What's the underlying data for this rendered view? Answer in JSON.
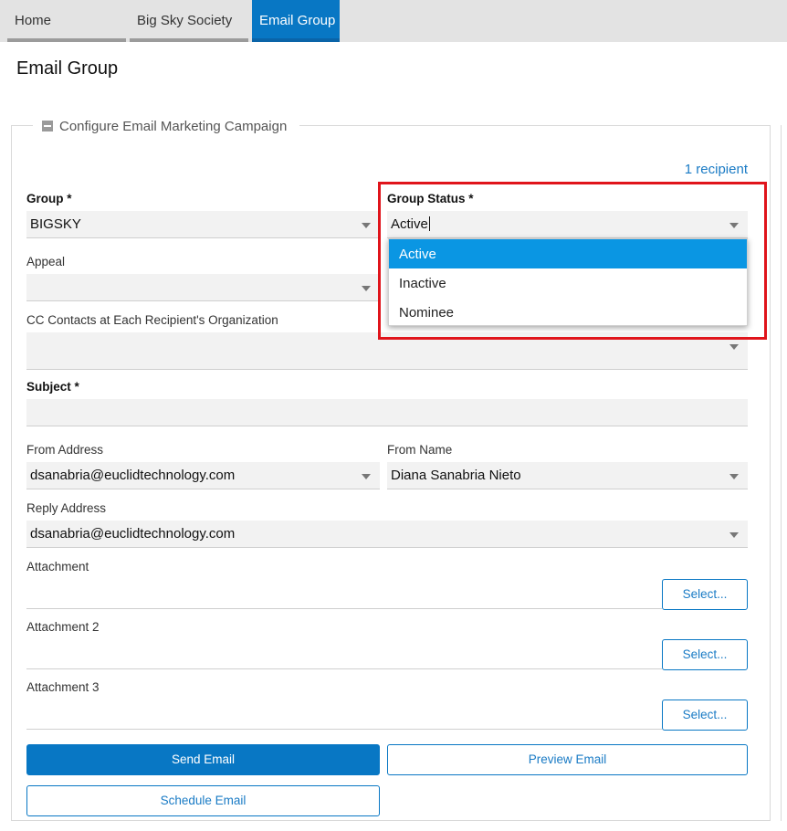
{
  "tabs": [
    "Home",
    "Big Sky Society",
    "Email Group"
  ],
  "page_title": "Email Group",
  "section_title": "Configure Email Marketing Campaign",
  "recipients_link": "1 recipient",
  "form": {
    "group_label": "Group *",
    "group_value": "BIGSKY",
    "group_status_label": "Group Status *",
    "group_status_value": "Active",
    "appeal_label": "Appeal",
    "appeal_value": "",
    "cc_label": "CC Contacts at Each Recipient's Organization",
    "subject_label": "Subject *",
    "subject_value": "",
    "from_address_label": "From Address",
    "from_address_value": "dsanabria@euclidtechnology.com",
    "from_name_label": "From Name",
    "from_name_value": "Diana Sanabria Nieto",
    "reply_address_label": "Reply Address",
    "reply_address_value": "dsanabria@euclidtechnology.com",
    "attachment_label": "Attachment",
    "attachment2_label": "Attachment 2",
    "attachment3_label": "Attachment 3",
    "select_button": "Select..."
  },
  "status_options": [
    "Active",
    "Inactive",
    "Nominee"
  ],
  "buttons": {
    "send": "Send Email",
    "preview": "Preview Email",
    "schedule": "Schedule Email"
  },
  "colors": {
    "accent": "#0877c4",
    "dropdown_selected": "#0a96e3",
    "highlight": "#e0141b"
  }
}
